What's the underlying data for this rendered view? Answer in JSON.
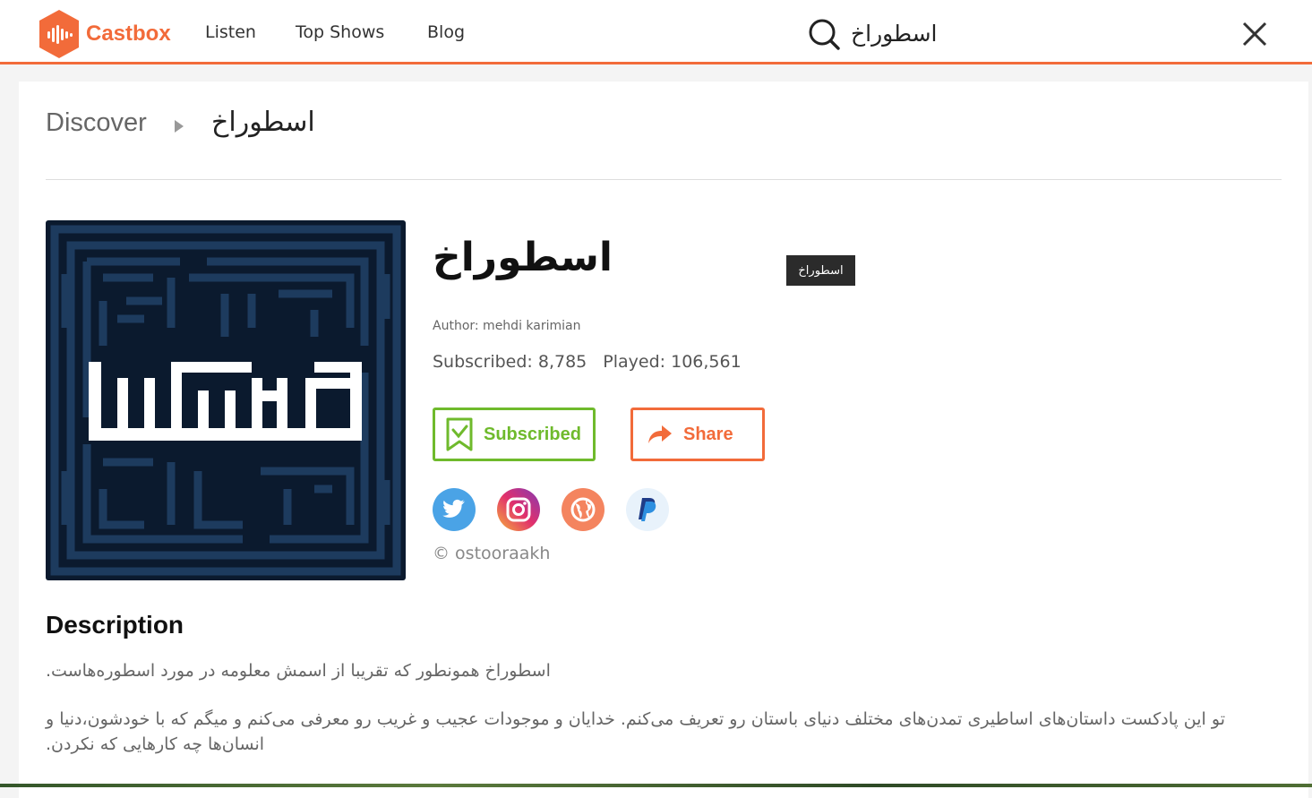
{
  "brand": {
    "name": "Castbox",
    "accent": "#f26b3a"
  },
  "nav": {
    "items": [
      {
        "label": "Listen"
      },
      {
        "label": "Top Shows"
      },
      {
        "label": "Blog"
      }
    ]
  },
  "search": {
    "value": "اسطوراخ"
  },
  "breadcrumb": {
    "root": "Discover",
    "current": "اسطوراخ"
  },
  "show": {
    "title": "اسطوراخ",
    "tooltip": "اسطوراخ",
    "author": "Author: mehdi karimian",
    "subscribed": "Subscribed: 8,785",
    "played": "Played: 106,561",
    "subscribe_label": "Subscribed",
    "share_label": "Share",
    "copyright": "© ostooraakh",
    "social": [
      "twitter-icon",
      "instagram-icon",
      "website-icon",
      "paypal-icon"
    ]
  },
  "description": {
    "heading": "Description",
    "paragraphs": [
      "اسطوراخ همونطور که تقریبا از اسمش معلومه در مورد اسطوره‌هاست.",
      "تو این پادکست داستان‌های اساطیری تمدن‌های مختلف دنیای باستان رو تعریف می‌کنم. خدایان و موجودات عجیب و غریب رو معرفی می‌کنم و میگم که با خودشون،دنیا و انسان‌ها چه کارهایی که نکردن."
    ]
  },
  "colors": {
    "subscribed": "#6fba2c",
    "share": "#f26b3a",
    "cover_bg": "#0b1a2e"
  }
}
